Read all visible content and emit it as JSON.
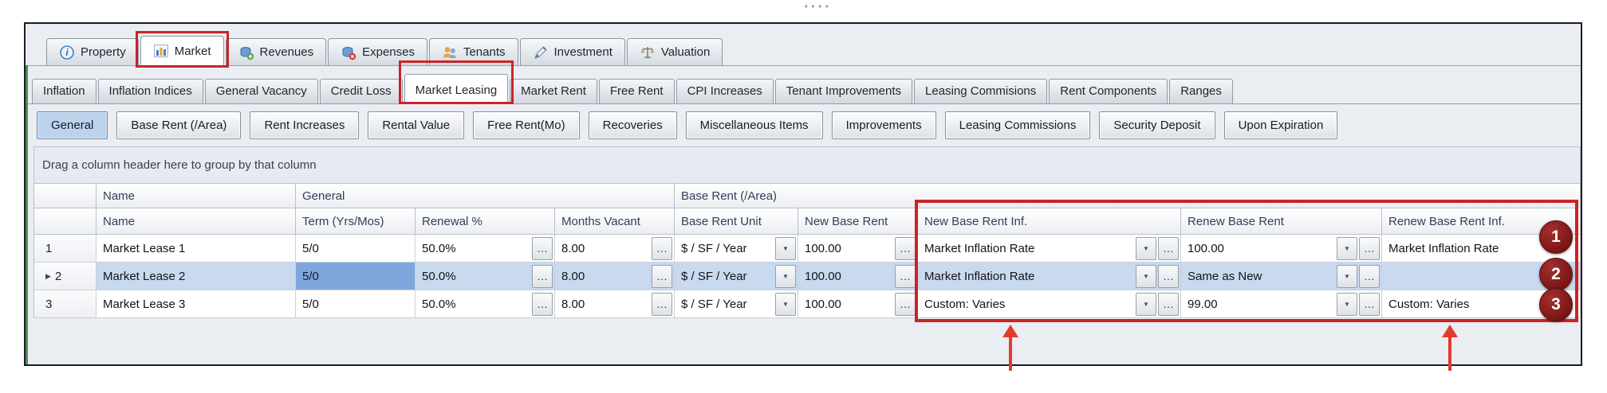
{
  "window": {
    "drag_handle_dots": "····",
    "main_tabs": [
      "Property",
      "Market",
      "Revenues",
      "Expenses",
      "Tenants",
      "Investment",
      "Valuation"
    ],
    "sub_tabs": [
      "Inflation",
      "Inflation Indices",
      "General Vacancy",
      "Credit Loss",
      "Market Leasing",
      "Market Rent",
      "Free Rent",
      "CPI Increases",
      "Tenant Improvements",
      "Leasing Commisions",
      "Rent Components",
      "Ranges"
    ],
    "section_buttons": [
      "General",
      "Base Rent (/Area)",
      "Rent Increases",
      "Rental Value",
      "Free Rent(Mo)",
      "Recoveries",
      "Miscellaneous Items",
      "Improvements",
      "Leasing Commissions",
      "Security Deposit",
      "Upon Expiration"
    ],
    "active": {
      "main_tab": "Market",
      "sub_tab": "Market Leasing",
      "section_button": "General"
    },
    "group_by_hint": "Drag a column header here to group by that column"
  },
  "grid": {
    "band_headers": {
      "name": "Name",
      "general": "General",
      "base_rent_area": "Base Rent (/Area)"
    },
    "columns": {
      "name": "Name",
      "term": "Term (Yrs/Mos)",
      "renewal": "Renewal %",
      "months_vacant": "Months Vacant",
      "base_rent_unit": "Base Rent Unit",
      "new_base_rent": "New Base Rent",
      "new_base_rent_inf": "New Base Rent Inf.",
      "renew_base_rent": "Renew Base Rent",
      "renew_base_rent_inf": "Renew Base Rent Inf."
    },
    "rows": [
      {
        "num": "1",
        "name": "Market Lease 1",
        "term": "5/0",
        "renewal": "50.0%",
        "months_vacant": "8.00",
        "base_rent_unit": "$ / SF / Year",
        "new_base_rent": "100.00",
        "new_base_rent_inf": "Market Inflation Rate",
        "renew_base_rent": "100.00",
        "renew_base_rent_inf": "Market Inflation Rate"
      },
      {
        "num": "2",
        "name": "Market Lease 2",
        "term": "5/0",
        "renewal": "50.0%",
        "months_vacant": "8.00",
        "base_rent_unit": "$ / SF / Year",
        "new_base_rent": "100.00",
        "new_base_rent_inf": "Market Inflation Rate",
        "renew_base_rent": "Same as New",
        "renew_base_rent_inf": ""
      },
      {
        "num": "3",
        "name": "Market Lease 3",
        "term": "5/0",
        "renewal": "50.0%",
        "months_vacant": "8.00",
        "base_rent_unit": "$ / SF / Year",
        "new_base_rent": "100.00",
        "new_base_rent_inf": "Custom: Varies",
        "renew_base_rent": "99.00",
        "renew_base_rent_inf": "Custom: Varies"
      }
    ]
  },
  "icons": {
    "ellipsis": "…",
    "dropdown": "▼",
    "current_row_marker": "▶"
  },
  "annotations": {
    "badges": [
      "1",
      "2",
      "3"
    ],
    "accent_red": "#cb2326"
  }
}
